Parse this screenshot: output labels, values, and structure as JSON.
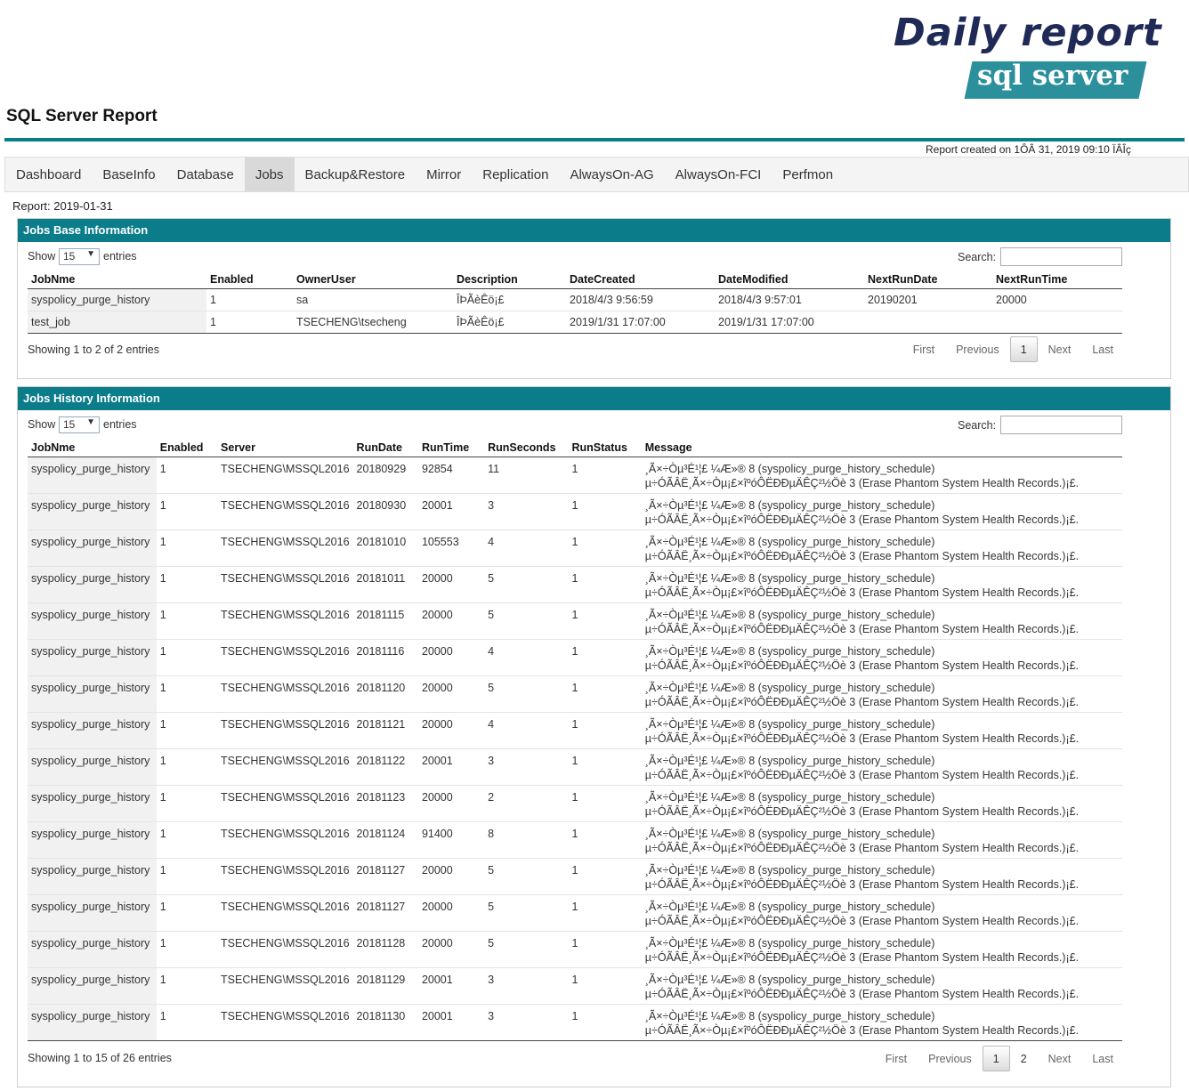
{
  "logo": {
    "line1": "Daily report",
    "line2": "sql server"
  },
  "page_title": "SQL Server Report",
  "report_created": "Report created on 1ÔÂ 31, 2019 09:10 ÏÂÎç",
  "nav": {
    "items": [
      "Dashboard",
      "BaseInfo",
      "Database",
      "Jobs",
      "Backup&Restore",
      "Mirror",
      "Replication",
      "AlwaysOn-AG",
      "AlwaysOn-FCI",
      "Perfmon"
    ],
    "active": "Jobs"
  },
  "report_date": "Report: 2019-01-31",
  "jobs_base": {
    "title": "Jobs Base Information",
    "show_label": "Show",
    "page_size": "15",
    "entries_label": "entries",
    "search_label": "Search:",
    "columns": [
      "JobNme",
      "Enabled",
      "OwnerUser",
      "Description",
      "DateCreated",
      "DateModified",
      "NextRunDate",
      "NextRunTime"
    ],
    "rows": [
      [
        "syspolicy_purge_history",
        "1",
        "sa",
        "ÎÞÃèÊö¡£",
        "2018/4/3 9:56:59",
        "2018/4/3 9:57:01",
        "20190201",
        "20000"
      ],
      [
        "test_job",
        "1",
        "TSECHENG\\tsecheng",
        "ÎÞÃèÊö¡£",
        "2019/1/31 17:07:00",
        "2019/1/31 17:07:00",
        "",
        ""
      ]
    ],
    "info": "Showing 1 to 2 of 2 entries",
    "pager": {
      "first": "First",
      "previous": "Previous",
      "pages": [
        "1"
      ],
      "next": "Next",
      "last": "Last"
    }
  },
  "jobs_history": {
    "title": "Jobs History Information",
    "show_label": "Show",
    "page_size": "15",
    "entries_label": "entries",
    "search_label": "Search:",
    "columns": [
      "JobNme",
      "Enabled",
      "Server",
      "RunDate",
      "RunTime",
      "RunSeconds",
      "RunStatus",
      "Message"
    ],
    "message_line1": "¸Ã×÷Òµ³É¹¦£ ¼Æ»® 8 (syspolicy_purge_history_schedule)",
    "message_line2": "µ÷ÓÃÂË¸Ã×÷Òµ¡£×îºóÔËÐÐµÄÊÇ²½Öè 3 (Erase Phantom System Health Records.)¡£.",
    "rows": [
      [
        "syspolicy_purge_history",
        "1",
        "TSECHENG\\MSSQL2016",
        "20180929",
        "92854",
        "11",
        "1"
      ],
      [
        "syspolicy_purge_history",
        "1",
        "TSECHENG\\MSSQL2016",
        "20180930",
        "20001",
        "3",
        "1"
      ],
      [
        "syspolicy_purge_history",
        "1",
        "TSECHENG\\MSSQL2016",
        "20181010",
        "105553",
        "4",
        "1"
      ],
      [
        "syspolicy_purge_history",
        "1",
        "TSECHENG\\MSSQL2016",
        "20181011",
        "20000",
        "5",
        "1"
      ],
      [
        "syspolicy_purge_history",
        "1",
        "TSECHENG\\MSSQL2016",
        "20181115",
        "20000",
        "5",
        "1"
      ],
      [
        "syspolicy_purge_history",
        "1",
        "TSECHENG\\MSSQL2016",
        "20181116",
        "20000",
        "4",
        "1"
      ],
      [
        "syspolicy_purge_history",
        "1",
        "TSECHENG\\MSSQL2016",
        "20181120",
        "20000",
        "5",
        "1"
      ],
      [
        "syspolicy_purge_history",
        "1",
        "TSECHENG\\MSSQL2016",
        "20181121",
        "20000",
        "4",
        "1"
      ],
      [
        "syspolicy_purge_history",
        "1",
        "TSECHENG\\MSSQL2016",
        "20181122",
        "20001",
        "3",
        "1"
      ],
      [
        "syspolicy_purge_history",
        "1",
        "TSECHENG\\MSSQL2016",
        "20181123",
        "20000",
        "2",
        "1"
      ],
      [
        "syspolicy_purge_history",
        "1",
        "TSECHENG\\MSSQL2016",
        "20181124",
        "91400",
        "8",
        "1"
      ],
      [
        "syspolicy_purge_history",
        "1",
        "TSECHENG\\MSSQL2016",
        "20181127",
        "20000",
        "5",
        "1"
      ],
      [
        "syspolicy_purge_history",
        "1",
        "TSECHENG\\MSSQL2016",
        "20181127",
        "20000",
        "5",
        "1"
      ],
      [
        "syspolicy_purge_history",
        "1",
        "TSECHENG\\MSSQL2016",
        "20181128",
        "20000",
        "5",
        "1"
      ],
      [
        "syspolicy_purge_history",
        "1",
        "TSECHENG\\MSSQL2016",
        "20181129",
        "20001",
        "3",
        "1"
      ],
      [
        "syspolicy_purge_history",
        "1",
        "TSECHENG\\MSSQL2016",
        "20181130",
        "20001",
        "3",
        "1"
      ]
    ],
    "info": "Showing 1 to 15 of 26 entries",
    "pager": {
      "first": "First",
      "previous": "Previous",
      "pages": [
        "1",
        "2"
      ],
      "next": "Next",
      "last": "Last"
    }
  }
}
